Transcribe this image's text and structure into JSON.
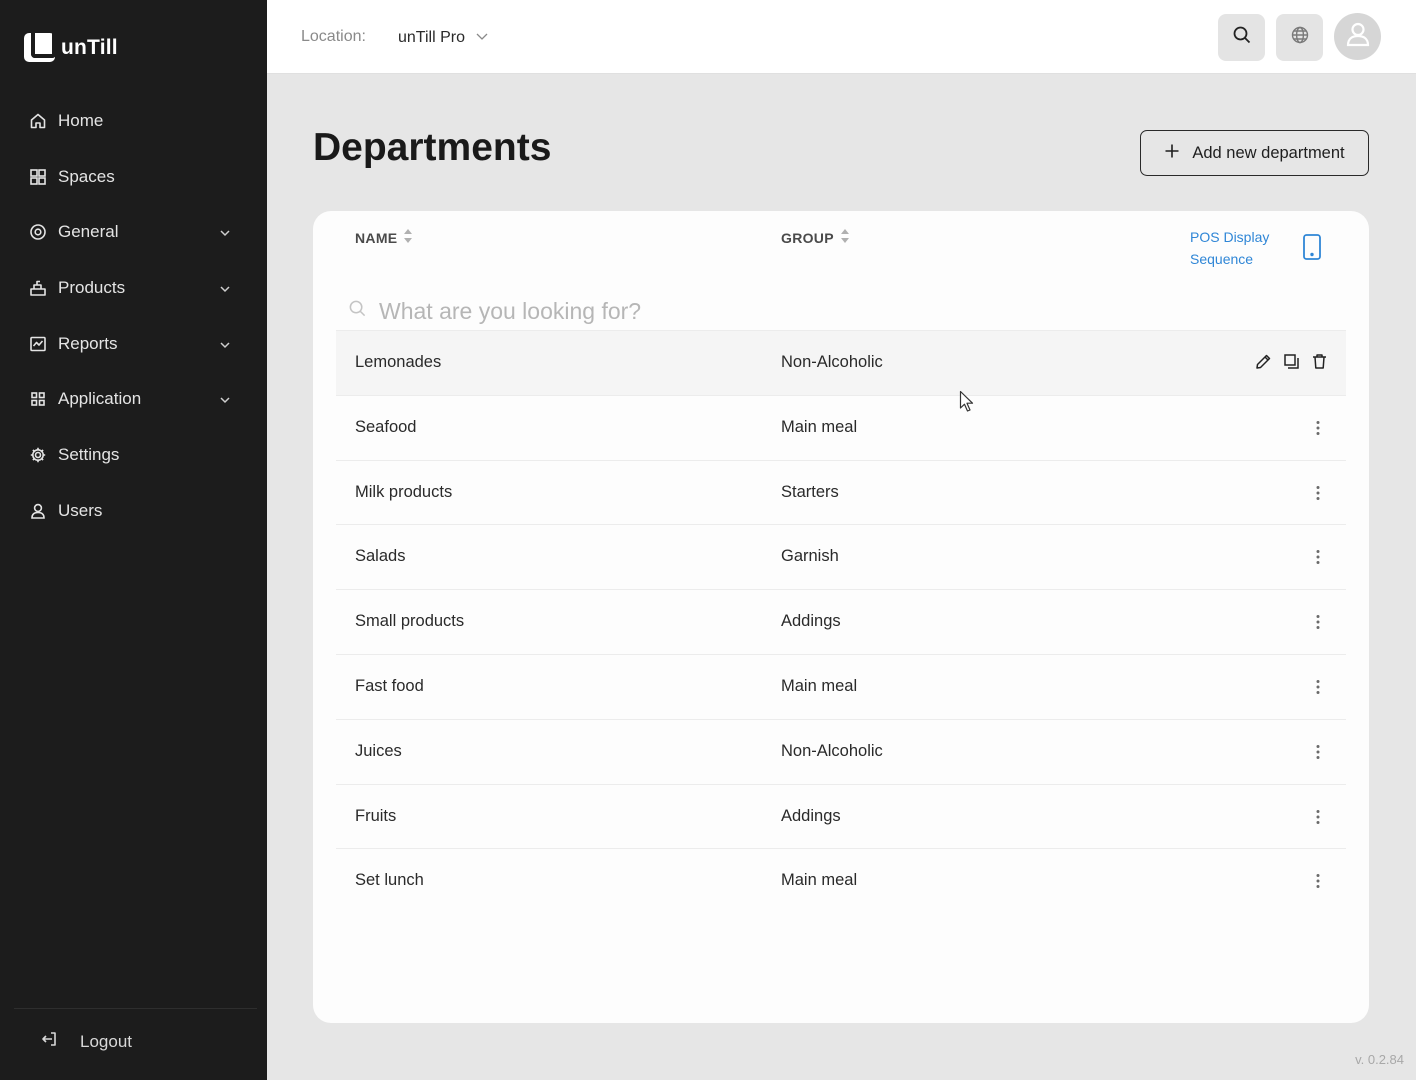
{
  "app": {
    "name": "unTill",
    "version": "v. 0.2.84"
  },
  "sidebar": {
    "items": [
      {
        "label": "Home",
        "icon": "home-icon",
        "expandable": false
      },
      {
        "label": "Spaces",
        "icon": "grid-icon",
        "expandable": false
      },
      {
        "label": "General",
        "icon": "target-icon",
        "expandable": true
      },
      {
        "label": "Products",
        "icon": "box-stack-icon",
        "expandable": true
      },
      {
        "label": "Reports",
        "icon": "chart-icon",
        "expandable": true
      },
      {
        "label": "Application",
        "icon": "apps-icon",
        "expandable": true
      },
      {
        "label": "Settings",
        "icon": "gear-icon",
        "expandable": false
      },
      {
        "label": "Users",
        "icon": "user-icon",
        "expandable": false
      }
    ],
    "logout_label": "Logout"
  },
  "topbar": {
    "location_label": "Location:",
    "location_value": "unTill Pro"
  },
  "page": {
    "title": "Departments",
    "add_button_label": "Add new department"
  },
  "table": {
    "columns": {
      "name": "NAME",
      "group": "GROUP",
      "pos_line1": "POS Display",
      "pos_line2": "Sequence"
    },
    "search_placeholder": "What are you looking for?",
    "rows": [
      {
        "name": "Lemonades",
        "group": "Non-Alcoholic"
      },
      {
        "name": "Seafood",
        "group": "Main meal"
      },
      {
        "name": "Milk products",
        "group": "Starters"
      },
      {
        "name": "Salads",
        "group": "Garnish"
      },
      {
        "name": "Small products",
        "group": "Addings"
      },
      {
        "name": "Fast food",
        "group": "Main meal"
      },
      {
        "name": "Juices",
        "group": "Non-Alcoholic"
      },
      {
        "name": "Fruits",
        "group": "Addings"
      },
      {
        "name": "Set lunch",
        "group": "Main meal"
      }
    ]
  },
  "colors": {
    "sidebar_bg": "#1c1c1c",
    "accent_link": "#2f86d6",
    "page_bg": "#e6e6e6"
  }
}
